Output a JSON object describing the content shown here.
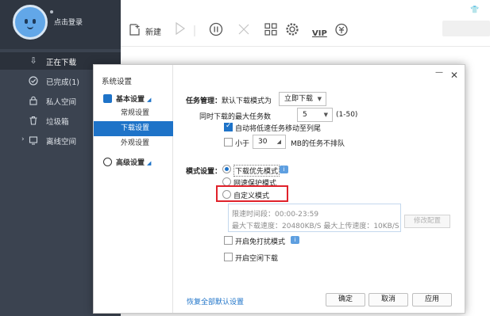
{
  "app": {
    "profile": {
      "login_text": "点击登录",
      "avatar_icon": "smiley-avatar-icon"
    },
    "sidebar": {
      "items": [
        {
          "label": "正在下载",
          "icon": "download-arrow-icon",
          "active": true
        },
        {
          "label": "已完成(1)",
          "icon": "check-circle-icon",
          "active": false
        },
        {
          "label": "私人空间",
          "icon": "lock-icon",
          "active": false
        },
        {
          "label": "垃圾箱",
          "icon": "trash-icon",
          "active": false
        },
        {
          "label": "离线空间",
          "icon": "cloud-monitor-icon",
          "active": false
        }
      ]
    },
    "toolbar": {
      "new_label": "新建",
      "vip_label": "VIP",
      "icons": [
        "new-file-icon",
        "play-icon",
        "pause-icon",
        "close-icon",
        "grid-icon",
        "gear-icon",
        "vip-icon",
        "bell-icon"
      ]
    },
    "colors": {
      "sidebar_bg": "#3b4350",
      "accent": "#1e73c8",
      "highlight": "#e0222b"
    }
  },
  "dialog": {
    "title": "系统设置",
    "nav": {
      "basic_group": "基本设置",
      "items": [
        "常规设置",
        "下载设置",
        "外观设置"
      ],
      "selected": "下载设置",
      "advanced_group": "高级设置"
    },
    "task": {
      "section_label": "任务管理：",
      "default_mode_label": "默认下载模式为",
      "default_mode_value": "立即下载",
      "max_tasks_label": "同时下载的最大任务数",
      "max_tasks_value": "5",
      "max_tasks_range": "(1-50)",
      "auto_move_label": "自动将低速任务移动至列尾",
      "auto_move_checked": true,
      "less_than_label": "小于",
      "less_than_value": "30",
      "less_than_suffix": "MB的任务不排队",
      "less_than_checked": false
    },
    "mode": {
      "section_label": "模式设置：",
      "options": [
        {
          "label": "下载优先模式",
          "checked": true
        },
        {
          "label": "网速保护模式",
          "checked": false
        },
        {
          "label": "自定义模式",
          "checked": false
        }
      ],
      "speed_period": "限速时间段：00:00-23:59",
      "speed_limits": "最大下载速度：20480KB/S  最大上传速度：10KB/S",
      "modify_button": "修改配置",
      "no_disturb_label": "开启免打扰模式",
      "idle_download_label": "开启空闲下载"
    },
    "footer": {
      "restore_link": "恢复全部默认设置",
      "ok_button": "确定",
      "cancel_button": "取消",
      "apply_button": "应用"
    }
  }
}
